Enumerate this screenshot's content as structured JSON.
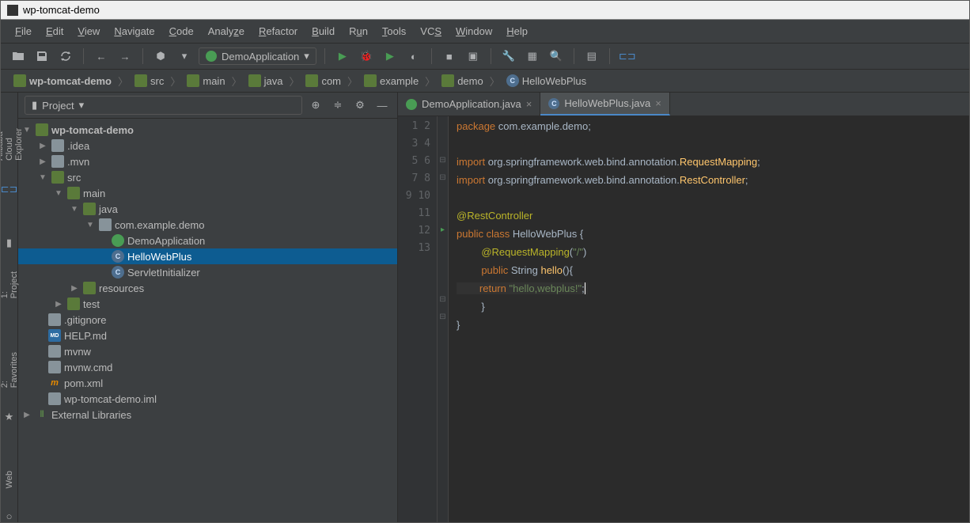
{
  "window": {
    "title": "wp-tomcat-demo"
  },
  "menu": [
    "File",
    "Edit",
    "View",
    "Navigate",
    "Code",
    "Analyze",
    "Refactor",
    "Build",
    "Run",
    "Tools",
    "VCS",
    "Window",
    "Help"
  ],
  "runConfig": "DemoApplication",
  "breadcrumb": [
    {
      "icon": "folder",
      "label": "wp-tomcat-demo"
    },
    {
      "icon": "folder",
      "label": "src"
    },
    {
      "icon": "folder",
      "label": "main"
    },
    {
      "icon": "folder",
      "label": "java"
    },
    {
      "icon": "folder",
      "label": "com"
    },
    {
      "icon": "folder",
      "label": "example"
    },
    {
      "icon": "folder",
      "label": "demo"
    },
    {
      "icon": "class",
      "label": "HelloWebPlus"
    }
  ],
  "projectPanel": {
    "title": "Project"
  },
  "tree": {
    "root": "wp-tomcat-demo",
    "idea": ".idea",
    "mvn": ".mvn",
    "src": "src",
    "main": "main",
    "java": "java",
    "pkg": "com.example.demo",
    "demoApp": "DemoApplication",
    "hello": "HelloWebPlus",
    "servlet": "ServletInitializer",
    "resources": "resources",
    "test": "test",
    "gitignore": ".gitignore",
    "helpmd": "HELP.md",
    "mvnw": "mvnw",
    "mvnwcmd": "mvnw.cmd",
    "pom": "pom.xml",
    "iml": "wp-tomcat-demo.iml",
    "extlib": "External Libraries"
  },
  "tabs": [
    {
      "label": "DemoApplication.java",
      "active": false,
      "icon": "green"
    },
    {
      "label": "HelloWebPlus.java",
      "active": true,
      "icon": "blue"
    }
  ],
  "code": {
    "l1_kw": "package",
    "l1_txt": " com.example.demo;",
    "l3_kw": "import",
    "l3_txt": " org.springframework.web.bind.annotation.",
    "l3_cls": "RequestMapping",
    "l3_end": ";",
    "l4_kw": "import",
    "l4_txt": " org.springframework.web.bind.annotation.",
    "l4_cls": "RestController",
    "l4_end": ";",
    "l6_ann": "@RestController",
    "l7_kw1": "public ",
    "l7_kw2": "class ",
    "l7_cls": "HelloWebPlus",
    "l7_txt": " {",
    "l8_ann": "@RequestMapping",
    "l8_txt": "(",
    "l8_str": "\"/\"",
    "l8_txt2": ")",
    "l9_kw1": "public ",
    "l9_cls": "String ",
    "l9_fn": "hello",
    "l9_txt": "(){",
    "l10_kw": "return ",
    "l10_str": "\"hello,webplus!\"",
    "l10_txt": ";",
    "l11": "}",
    "l12": "}"
  },
  "leftTools": {
    "cloud": "Alibaba Cloud Explorer",
    "project": "1: Project",
    "fav": "2: Favorites",
    "web": "Web"
  }
}
